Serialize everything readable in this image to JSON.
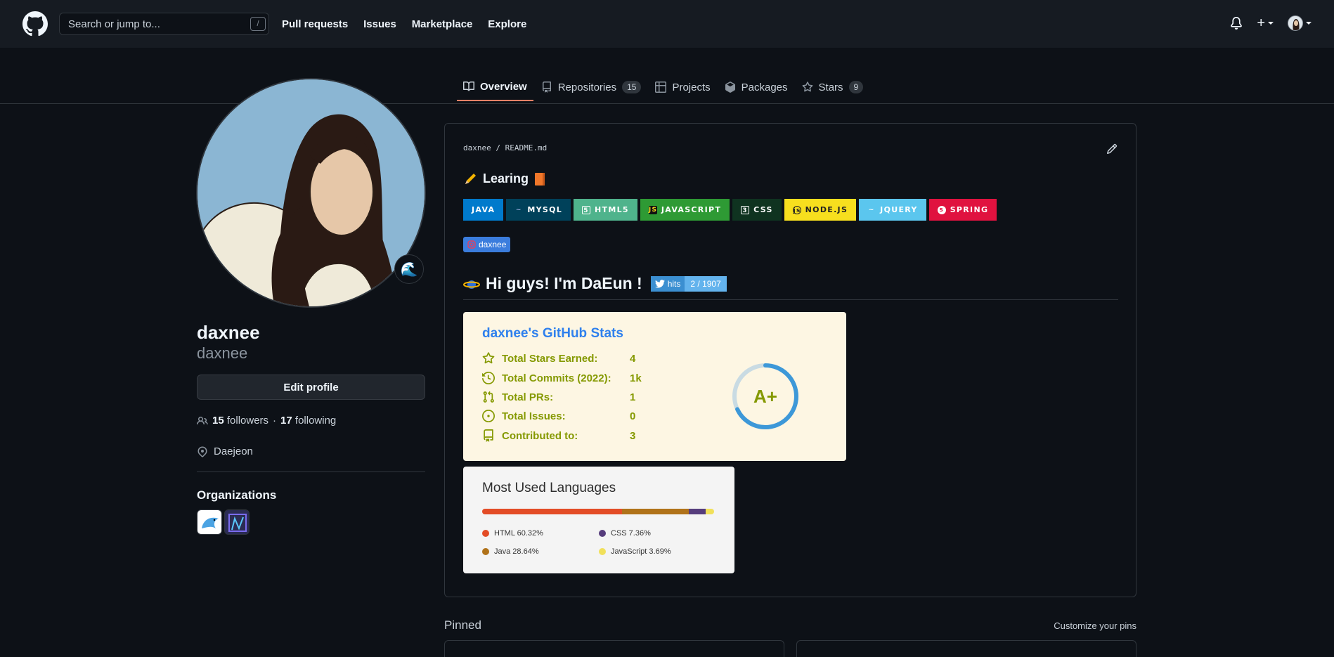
{
  "header": {
    "search_placeholder": "Search or jump to...",
    "search_shortcut": "/",
    "nav": [
      "Pull requests",
      "Issues",
      "Marketplace",
      "Explore"
    ],
    "plus_label": "+"
  },
  "tabs": [
    {
      "label": "Overview",
      "count": ""
    },
    {
      "label": "Repositories",
      "count": "15"
    },
    {
      "label": "Projects",
      "count": ""
    },
    {
      "label": "Packages",
      "count": ""
    },
    {
      "label": "Stars",
      "count": "9"
    }
  ],
  "profile": {
    "name": "daxnee",
    "login": "daxnee",
    "status_emoji": "🌊",
    "edit_button": "Edit profile",
    "followers_count": "15",
    "followers_label": "followers",
    "separator": "·",
    "following_count": "17",
    "following_label": "following",
    "location": "Daejeon",
    "organizations_title": "Organizations"
  },
  "readme": {
    "path_user": "daxnee",
    "path_sep": "/",
    "path_file": "README.md",
    "learning_heading": "Learing",
    "badges": [
      {
        "label": "JAVA",
        "bg": "#007ACC",
        "icon_bg": "#007ACC",
        "icon": ""
      },
      {
        "label": "MYSQL",
        "bg": "#00415A",
        "icon_bg": "#00415A",
        "icon": "my"
      },
      {
        "label": "HTML5",
        "bg": "#4FB38C",
        "icon_bg": "#4FB38C",
        "icon": "5"
      },
      {
        "label": "JAVASCRIPT",
        "bg": "#2E9A34",
        "icon_bg": "#111111",
        "icon": "JS"
      },
      {
        "label": "CSS",
        "bg": "#0F3320",
        "icon_bg": "#0F3320",
        "icon": "3"
      },
      {
        "label": "NODE.JS",
        "bg": "#F7DF1E",
        "icon_bg": "#F7DF1E",
        "icon": "JS"
      },
      {
        "label": "JQUERY",
        "bg": "#5BC6EE",
        "icon_bg": "#5BC6EE",
        "icon": "~"
      },
      {
        "label": "SPRING",
        "bg": "#E0123F",
        "icon_bg": "#E0123F",
        "icon": "S"
      }
    ],
    "mini_badge": "daxnee",
    "greeting": "Hi guys! I'm DaEun !",
    "hits_label": "hits",
    "hits_value": "2 / 1907"
  },
  "stats_card": {
    "title": "daxnee's GitHub Stats",
    "rows": [
      {
        "icon": "star-icon",
        "label": "Total Stars Earned:",
        "value": "4"
      },
      {
        "icon": "clock-icon",
        "label": "Total Commits (2022):",
        "value": "1k"
      },
      {
        "icon": "pr-icon",
        "label": "Total PRs:",
        "value": "1"
      },
      {
        "icon": "issue-icon",
        "label": "Total Issues:",
        "value": "0"
      },
      {
        "icon": "repo-icon",
        "label": "Contributed to:",
        "value": "3"
      }
    ],
    "rank": "A+",
    "rank_progress": 0.68,
    "colors": {
      "bg": "#fdf6e3",
      "title": "#2f80ed",
      "text": "#859900",
      "ring": "#3d98d8"
    }
  },
  "langs_card": {
    "title": "Most Used Languages",
    "languages": [
      {
        "name": "HTML",
        "percent": 60.32,
        "label": "HTML 60.32%",
        "color": "#e34c26"
      },
      {
        "name": "Java",
        "percent": 28.64,
        "label": "Java 28.64%",
        "color": "#b07219"
      },
      {
        "name": "CSS",
        "percent": 7.36,
        "label": "CSS 7.36%",
        "color": "#563d7c"
      },
      {
        "name": "JavaScript",
        "percent": 3.69,
        "label": "JavaScript 3.69%",
        "color": "#f1e05a"
      }
    ]
  },
  "pinned": {
    "title": "Pinned",
    "customize": "Customize your pins"
  }
}
